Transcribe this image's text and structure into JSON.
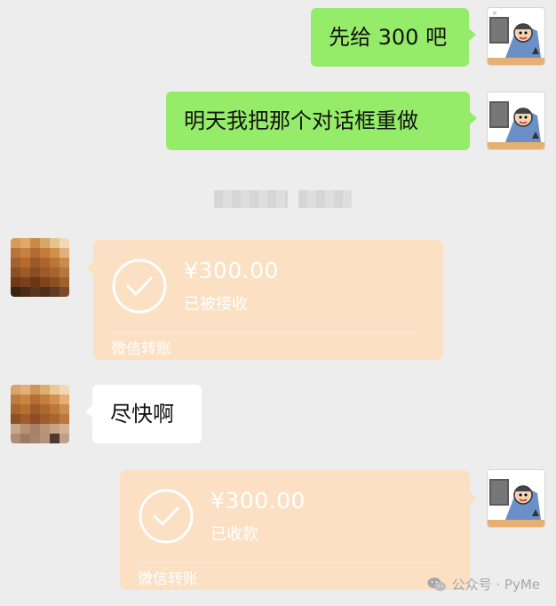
{
  "messages": {
    "m1": "先给 300 吧",
    "m2": "明天我把那个对话框重做",
    "m3": "尽快啊"
  },
  "transfers": [
    {
      "amount": "¥300.00",
      "status": "已被接收",
      "label": "微信转账"
    },
    {
      "amount": "¥300.00",
      "status": "已收款",
      "label": "微信转账"
    }
  ],
  "watermark": {
    "text": "公众号 · PyMe"
  },
  "colors": {
    "background": "#ededed",
    "sent_bubble": "#95ec69",
    "received_bubble": "#ffffff",
    "transfer_card": "#fbe0c3"
  },
  "icons": {
    "check": "check-circle-icon",
    "wechat": "wechat-icon"
  }
}
